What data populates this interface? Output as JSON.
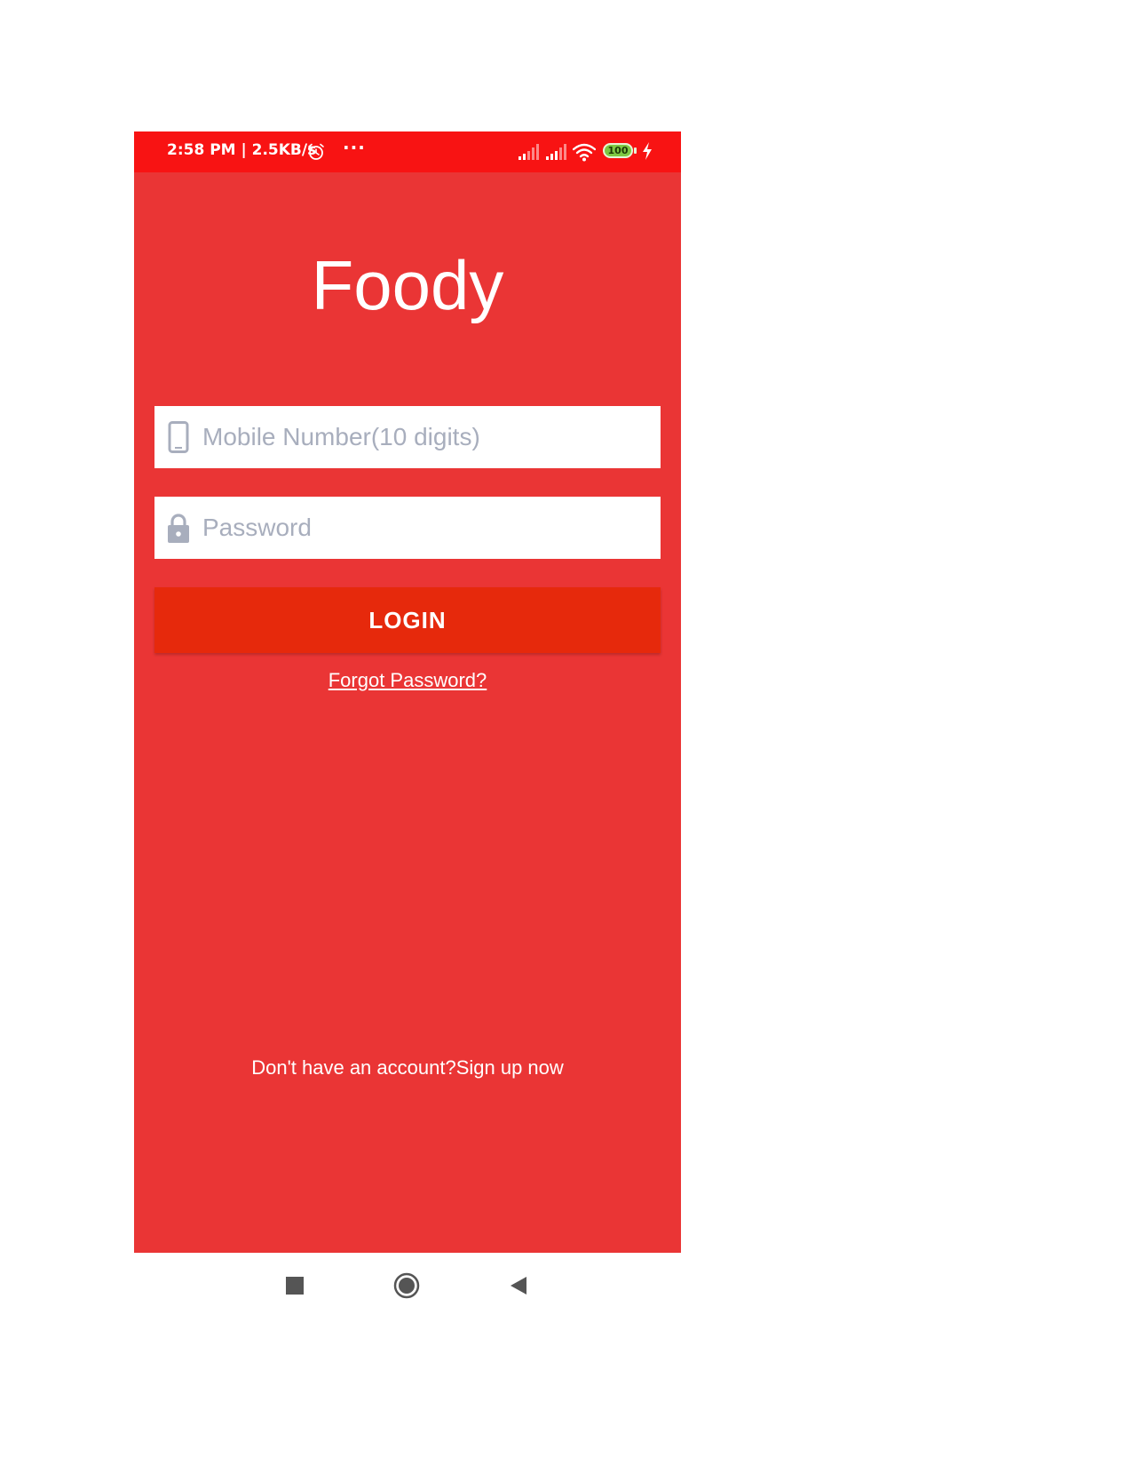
{
  "status_bar": {
    "time_speed": "2:58 PM | 2.5KB/s",
    "more": "···",
    "battery": "100"
  },
  "app": {
    "title": "Foody"
  },
  "form": {
    "mobile_placeholder": "Mobile Number(10 digits)",
    "password_placeholder": "Password",
    "login_label": "LOGIN",
    "forgot_label": "Forgot Password?",
    "signup_label": "Don't have an account?Sign up now"
  },
  "colors": {
    "background": "#ea3535",
    "status_bar": "#f81313",
    "login_button": "#e6290c",
    "placeholder": "#a8aebd"
  },
  "icons": [
    "alarm-icon",
    "signal-icon",
    "wifi-icon",
    "battery-icon",
    "charging-icon",
    "phone-icon",
    "lock-icon",
    "nav-recents-icon",
    "nav-home-icon",
    "nav-back-icon"
  ]
}
